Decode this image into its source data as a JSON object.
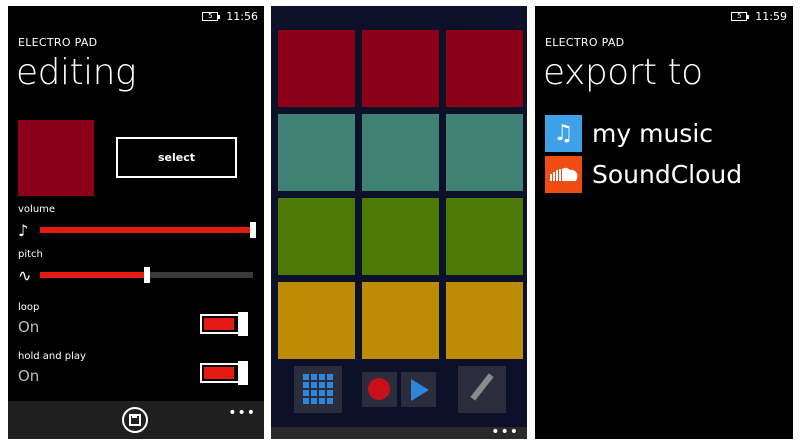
{
  "editing_screen": {
    "status": {
      "time": "11:56",
      "battery_text": "5"
    },
    "app_title": "ELECTRO PAD",
    "page_title": "editing",
    "color_swatch": "#8b0016",
    "select_label": "select",
    "volume": {
      "label": "volume",
      "icon": "music-note-icon",
      "value_pct": 100
    },
    "pitch": {
      "label": "pitch",
      "icon": "wave-icon",
      "value_pct": 50
    },
    "loop": {
      "label": "loop",
      "value": "On"
    },
    "hold_and_play": {
      "label": "hold and play",
      "value": "On"
    },
    "appbar": {
      "save_icon": "save-icon",
      "more": "•••"
    },
    "accent": "#e31b13"
  },
  "pad_screen": {
    "pad_colors": {
      "row1": "#8b0016",
      "row2": "#3f8273",
      "row3": "#4d7a07",
      "row4": "#bc8c05"
    },
    "rows": 4,
    "cols": 3,
    "toolbar": {
      "pads_icon": "grid-icon",
      "record_icon": "record-icon",
      "play_icon": "play-icon",
      "edit_icon": "pencil-icon"
    },
    "more": "•••"
  },
  "export_screen": {
    "status": {
      "time": "11:59",
      "battery_text": "5"
    },
    "app_title": "ELECTRO PAD",
    "page_title": "export to",
    "items": [
      {
        "label": "my music",
        "icon": "music-note-icon",
        "color": "#3fa2e8"
      },
      {
        "label": "SoundCloud",
        "icon": "soundcloud-icon",
        "color": "#f04d13"
      }
    ]
  }
}
